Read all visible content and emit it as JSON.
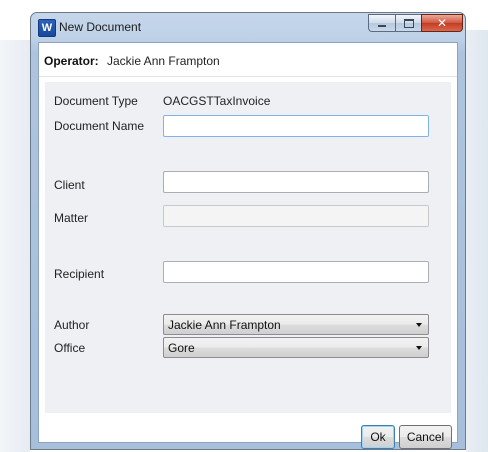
{
  "window": {
    "title": "New Document",
    "app_icon": "word-icon",
    "app_icon_letter": "W",
    "close_glyph": "✕"
  },
  "operator": {
    "label": "Operator:",
    "value": "Jackie Ann Frampton"
  },
  "form": {
    "document_type": {
      "label": "Document Type",
      "value": "OACGSTTaxInvoice"
    },
    "document_name": {
      "label": "Document Name",
      "value": ""
    },
    "client": {
      "label": "Client",
      "value": ""
    },
    "matter": {
      "label": "Matter",
      "value": ""
    },
    "recipient": {
      "label": "Recipient",
      "value": ""
    },
    "author": {
      "label": "Author",
      "selected": "Jackie Ann Frampton"
    },
    "office": {
      "label": "Office",
      "selected": "Gore"
    }
  },
  "buttons": {
    "ok": "Ok",
    "cancel": "Cancel"
  },
  "colors": {
    "title_bar": "#bfd2e8",
    "close_button": "#c13d24",
    "focus_border": "#7eb4ea"
  }
}
